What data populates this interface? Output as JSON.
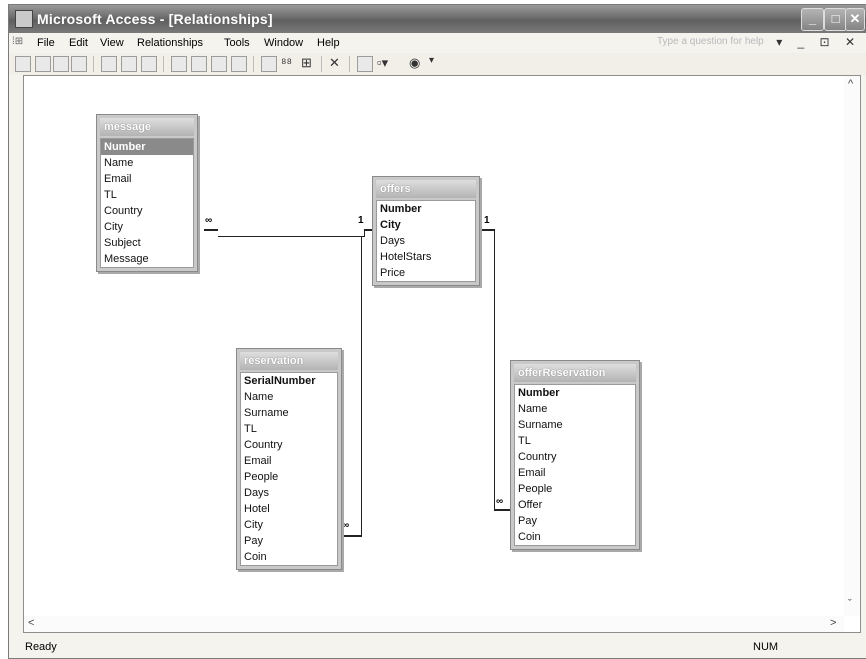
{
  "window": {
    "title": "Microsoft Access - [Relationships]"
  },
  "menu": {
    "items": [
      "File",
      "Edit",
      "View",
      "Relationships",
      "Tools",
      "Window",
      "Help"
    ],
    "help_placeholder": "Type a question for help",
    "window_controls": "▾ _ ⊡ ✕"
  },
  "tables": {
    "message": {
      "name": "message",
      "fields": [
        "Number",
        "Name",
        "Email",
        "TL",
        "Country",
        "City",
        "Subject",
        "Message"
      ]
    },
    "offers": {
      "name": "offers",
      "fields": [
        "Number",
        "City",
        "Days",
        "HotelStars",
        "Price"
      ]
    },
    "reservation": {
      "name": "reservation",
      "fields": [
        "SerialNumber",
        "Name",
        "Surname",
        "TL",
        "Country",
        "Email",
        "People",
        "Days",
        "Hotel",
        "City",
        "Pay",
        "Coin"
      ]
    },
    "offerReservation": {
      "name": "offerReservation",
      "fields": [
        "Number",
        "Name",
        "Surname",
        "TL",
        "Country",
        "Email",
        "People",
        "Offer",
        "Pay",
        "Coin"
      ]
    }
  },
  "relations": {
    "r1": {
      "left": "∞",
      "right": "1"
    },
    "r2": {
      "left": "1",
      "right": "∞"
    },
    "r3": {
      "left": "∞"
    }
  },
  "status": {
    "left": "Ready",
    "right": "NUM"
  }
}
